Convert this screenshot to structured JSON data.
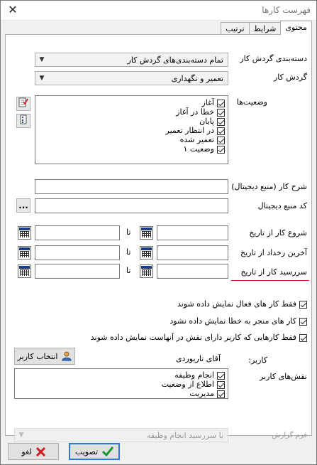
{
  "window": {
    "title": "فهرست کارها"
  },
  "tabs": [
    {
      "label": "محتوی",
      "active": true
    },
    {
      "label": "شرایط",
      "active": false
    },
    {
      "label": "ترتیب",
      "active": false
    }
  ],
  "form": {
    "category": {
      "label": "دسته‌بندی گردش کار",
      "value": "تمام دسته‌بندی‌های گردش کار"
    },
    "workflow": {
      "label": "گردش کار",
      "value": "تعمیر و نگهداری"
    },
    "statuses": {
      "label": "وضعیت‌ها",
      "items": [
        "آغاز",
        "خطا در آغاز",
        "پایان",
        "در انتظار تعمیر",
        "تعمیر شده",
        "وضعیت ۱"
      ]
    },
    "description": {
      "label": "شرح کار (منبع دیجیتال)",
      "value": ""
    },
    "code": {
      "label": "کد منبع دیجیتال",
      "value": "",
      "button": "..."
    },
    "date_rows": [
      {
        "label": "شروع کار از تاریخ",
        "to": "تا"
      },
      {
        "label": "آخرین رخداد از تاریخ",
        "to": "تا"
      },
      {
        "label": "سررسید کار از تاریخ",
        "to": "تا"
      }
    ],
    "options": [
      "فقط کار های فعال نمایش داده شوند",
      "کار های منجر به خطا نمایش داده نشود",
      "فقط کارهایی که کاربر دارای نقش در آنهاست نمایش داده شوند"
    ],
    "user": {
      "label": "کاربر:",
      "value": "آقای تاریوردی",
      "button": "انتخاب کاربر"
    },
    "roles": {
      "label": "نقش‌های کاربر",
      "items": [
        "انجام وظیفه",
        "اطلاع از وضعیت",
        "مدیریت"
      ]
    },
    "report_form": {
      "label": "فرم گزارش",
      "value": "با سررسید انجام وظیفه"
    }
  },
  "buttons": {
    "ok": "تصویب",
    "cancel": "لغو"
  },
  "colors": {
    "accent": "#2b78d8",
    "highlight_line": "#d81e1e",
    "ok_icon": "#1a9a2a",
    "cancel_icon": "#d11f1f"
  }
}
